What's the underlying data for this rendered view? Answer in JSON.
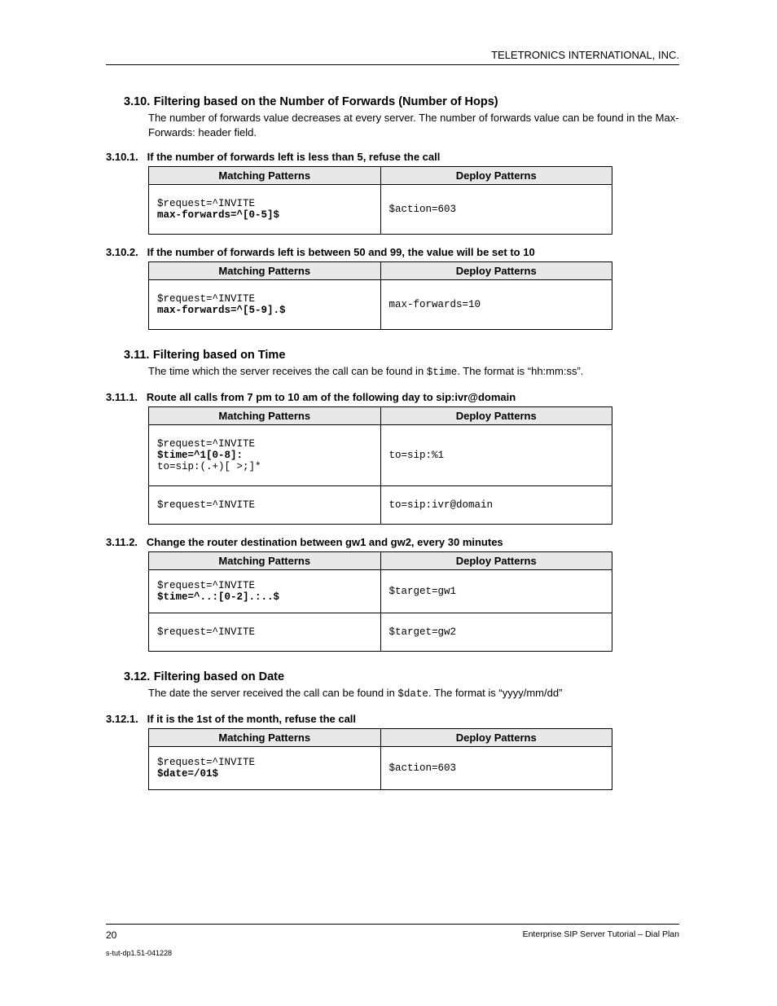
{
  "header": {
    "company": "TELETRONICS INTERNATIONAL, INC."
  },
  "s310": {
    "num": "3.10.",
    "title": "Filtering based on the Number of Forwards (Number of Hops)",
    "body": "The number of forwards value decreases at every server. The number of forwards value can be found in the Max-Forwards: header field.",
    "s1": {
      "num": "3.10.1.",
      "title": "If the number of forwards left is less than 5, refuse the call",
      "th1": "Matching Patterns",
      "th2": "Deploy Patterns",
      "m1a": "$request=^INVITE",
      "m1b": "max-forwards=^[0-5]$",
      "d1": "$action=603"
    },
    "s2": {
      "num": "3.10.2.",
      "title": "If the number of forwards left is between 50 and 99, the value will be set to 10",
      "th1": "Matching Patterns",
      "th2": "Deploy Patterns",
      "m1a": "$request=^INVITE",
      "m1b": "max-forwards=^[5-9].$",
      "d1": "max-forwards=10"
    }
  },
  "s311": {
    "num": "3.11.",
    "title": "Filtering based on Time",
    "body_a": "The time which the server receives the call can be found in ",
    "body_code": "$time",
    "body_b": ". The format is “hh:mm:ss”.",
    "s1": {
      "num": "3.11.1.",
      "title": "Route all calls from 7 pm to 10 am of the following day to sip:ivr@domain",
      "th1": "Matching Patterns",
      "th2": "Deploy Patterns",
      "m1a": "$request=^INVITE",
      "m1b": "$time=^1[0-8]:",
      "m1c": "to=sip:(.+)[ >;]*",
      "d1": "to=sip:%1",
      "m2": "$request=^INVITE",
      "d2": "to=sip:ivr@domain"
    },
    "s2": {
      "num": "3.11.2.",
      "title": "Change the router destination between gw1 and gw2, every 30 minutes",
      "th1": "Matching Patterns",
      "th2": "Deploy Patterns",
      "m1a": "$request=^INVITE",
      "m1b": "$time=^..:[0-2].:..$",
      "d1": "$target=gw1",
      "m2": "$request=^INVITE",
      "d2": "$target=gw2"
    }
  },
  "s312": {
    "num": "3.12.",
    "title": "Filtering based on Date",
    "body_a": "The date the server received the call can be found in ",
    "body_code": "$date",
    "body_b": ". The format is “yyyy/mm/dd”",
    "s1": {
      "num": "3.12.1.",
      "title": "If it is the 1st of the month, refuse the call",
      "th1": "Matching Patterns",
      "th2": "Deploy Patterns",
      "m1a": "$request=^INVITE",
      "m1b": "$date=/01$",
      "d1": "$action=603"
    }
  },
  "footer": {
    "page": "20",
    "doc": "Enterprise SIP Server Tutorial – Dial Plan",
    "docid": "s-tut-dp1.51-041228"
  }
}
